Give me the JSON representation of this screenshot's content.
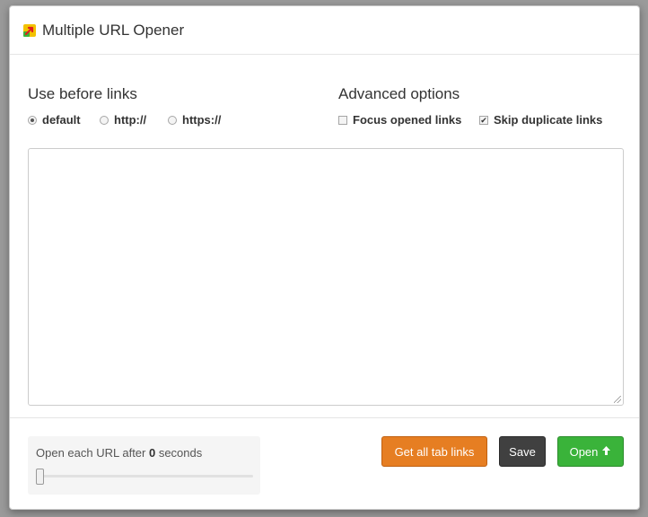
{
  "header": {
    "title": "Multiple URL Opener",
    "logo_icon": "arrow-logo-icon"
  },
  "prefix_section": {
    "title": "Use before links",
    "options": [
      {
        "label": "default",
        "checked": true
      },
      {
        "label": "http://",
        "checked": false
      },
      {
        "label": "https://",
        "checked": false
      }
    ]
  },
  "advanced_section": {
    "title": "Advanced options",
    "options": [
      {
        "label": "Focus opened links",
        "checked": false
      },
      {
        "label": "Skip duplicate links",
        "checked": true
      }
    ]
  },
  "links_textarea": {
    "value": ""
  },
  "delay": {
    "text_before": "Open each URL after ",
    "value": "0",
    "text_after": " seconds",
    "slider_fraction": 0
  },
  "buttons": {
    "get_tab_links": "Get all tab links",
    "save": "Save",
    "open": "Open"
  },
  "colors": {
    "orange": "#e67e22",
    "dark": "#404040",
    "green": "#3ab33a"
  }
}
